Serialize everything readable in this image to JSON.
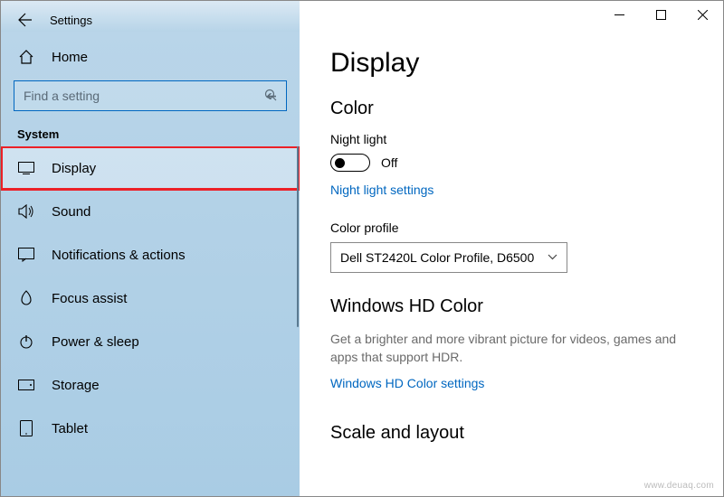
{
  "window": {
    "title": "Settings"
  },
  "sidebar": {
    "home_label": "Home",
    "search_placeholder": "Find a setting",
    "category_label": "System",
    "items": [
      {
        "label": "Display"
      },
      {
        "label": "Sound"
      },
      {
        "label": "Notifications & actions"
      },
      {
        "label": "Focus assist"
      },
      {
        "label": "Power & sleep"
      },
      {
        "label": "Storage"
      },
      {
        "label": "Tablet"
      }
    ]
  },
  "main": {
    "title": "Display",
    "color": {
      "heading": "Color",
      "night_light_label": "Night light",
      "night_light_state": "Off",
      "night_light_link": "Night light settings",
      "color_profile_label": "Color profile",
      "color_profile_value": "Dell ST2420L Color Profile, D6500"
    },
    "hdcolor": {
      "heading": "Windows HD Color",
      "desc": "Get a brighter and more vibrant picture for videos, games and apps that support HDR.",
      "link": "Windows HD Color settings"
    },
    "scale": {
      "heading": "Scale and layout"
    }
  },
  "watermark": "www.deuaq.com"
}
